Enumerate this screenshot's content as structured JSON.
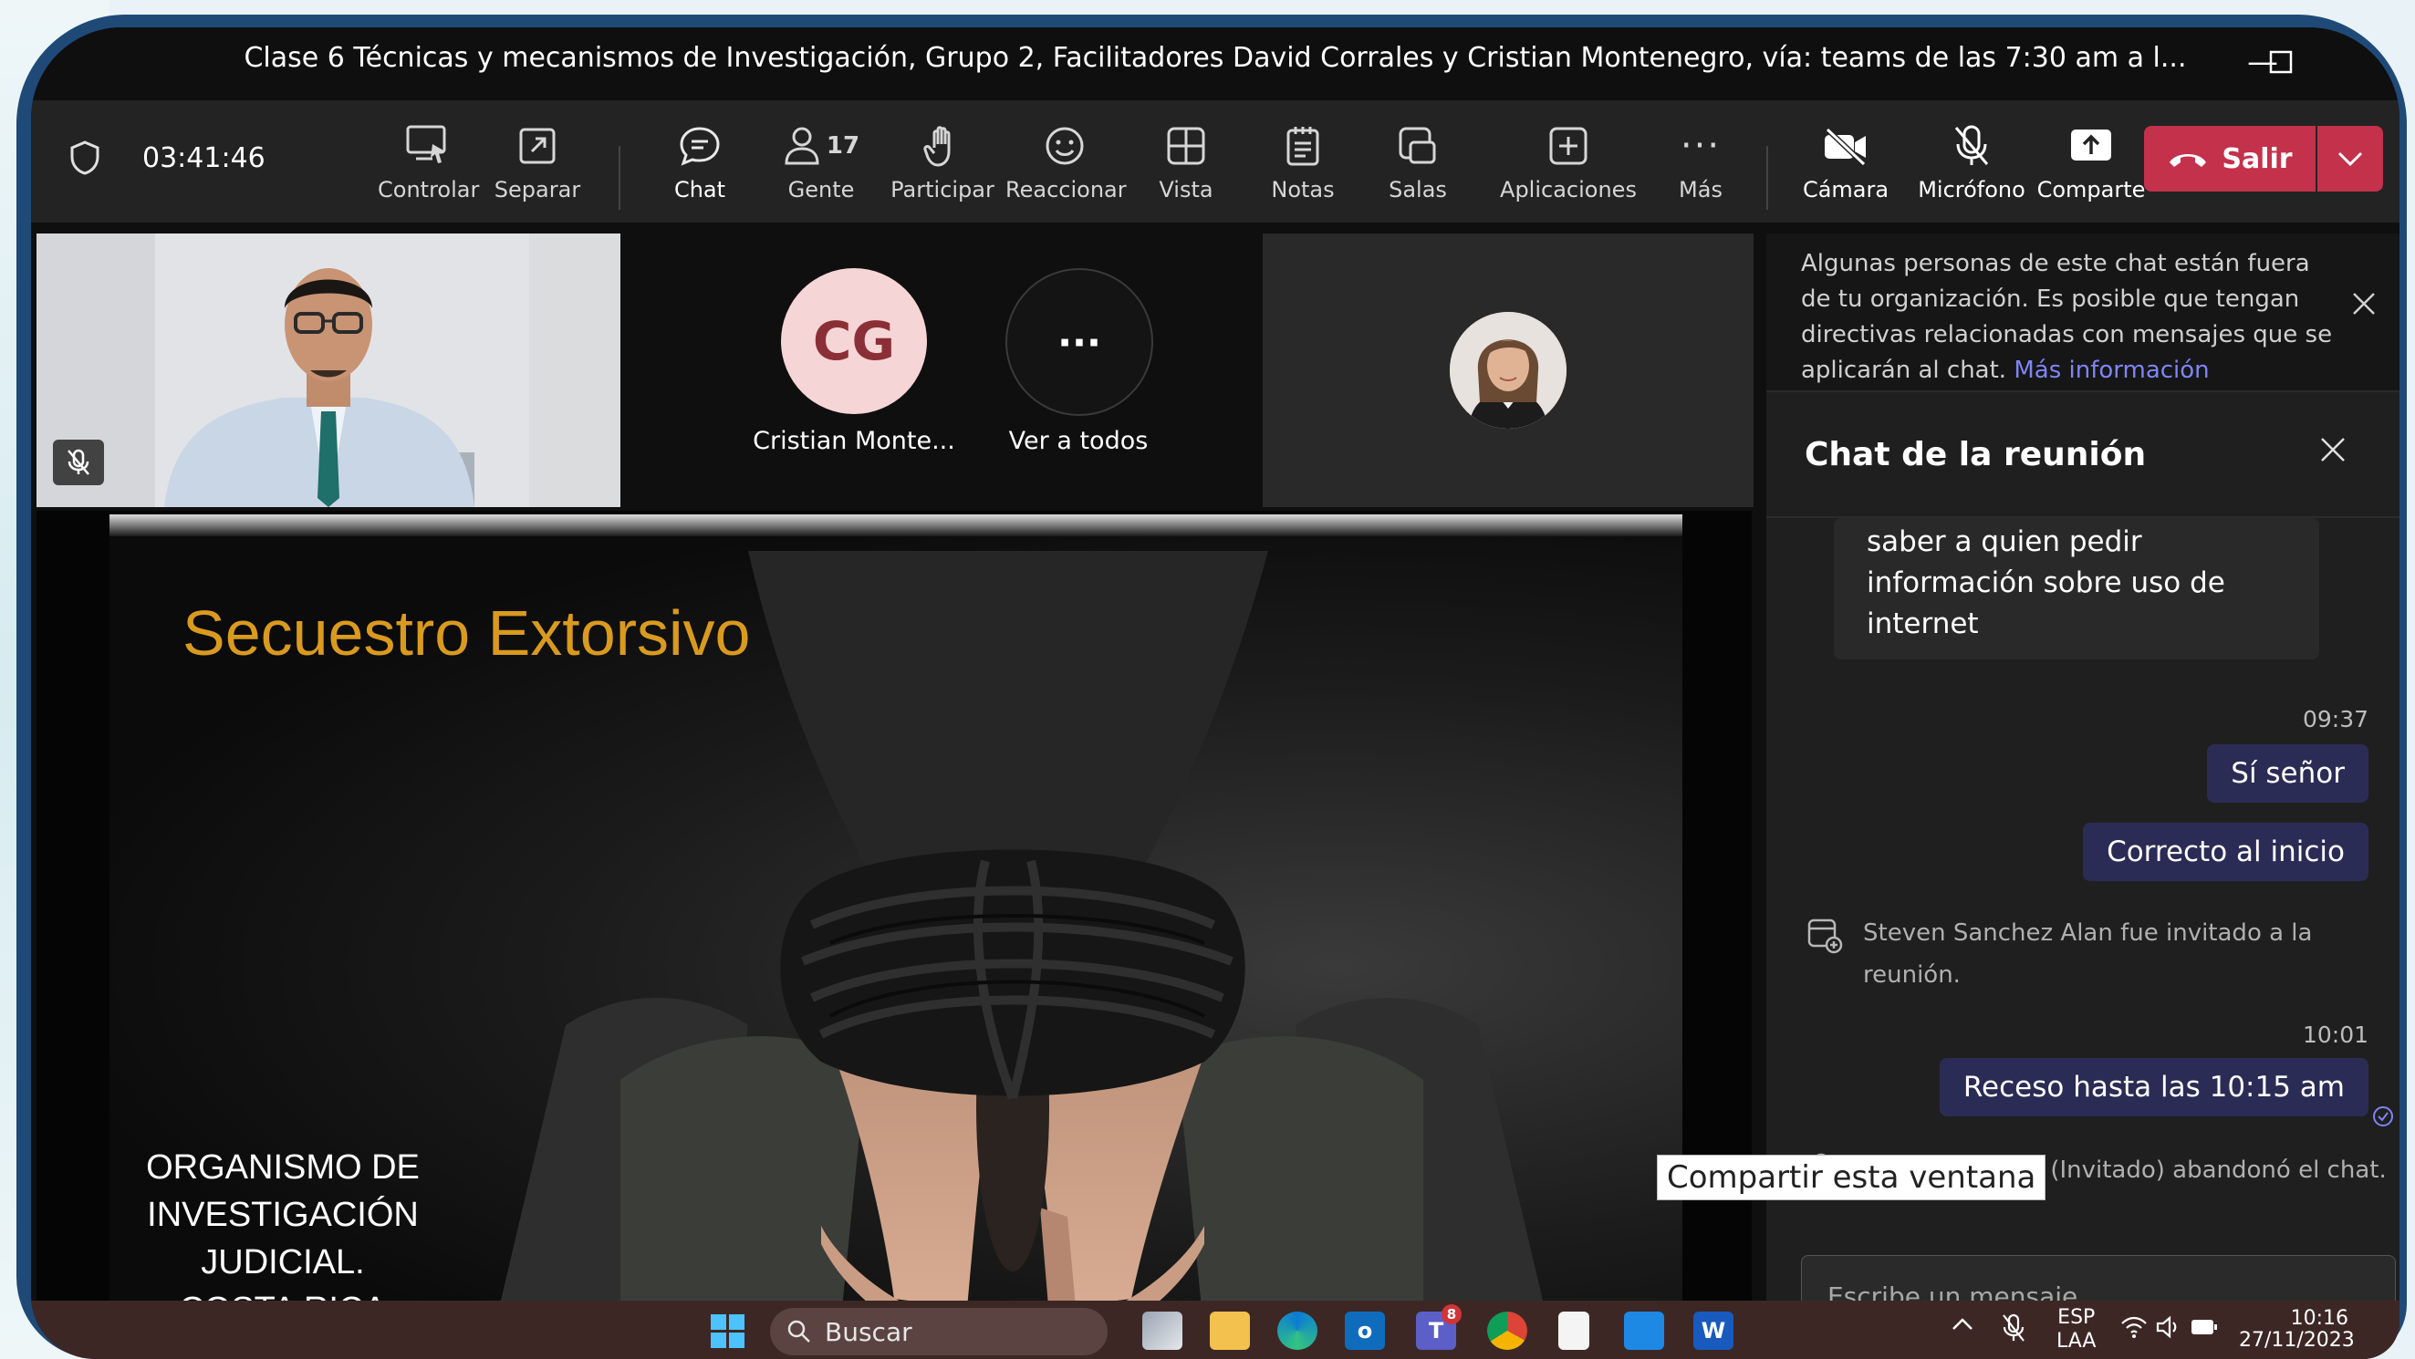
{
  "window": {
    "title": "Clase 6 Técnicas y mecanismos de Investigación,  Grupo 2, Facilitadores David Corrales y Cristian Montenegro, vía: teams de las 7:30  am a l..."
  },
  "toolbar": {
    "timer": "03:41:46",
    "controlar": "Controlar",
    "separar": "Separar",
    "chat": "Chat",
    "people_count": "17",
    "gente": "Gente",
    "participar": "Participar",
    "reaccionar": "Reaccionar",
    "vista": "Vista",
    "notas": "Notas",
    "salas": "Salas",
    "aplicaciones": "Aplicaciones",
    "mas": "Más",
    "camara": "Cámara",
    "microfono": "Micrófono",
    "comparte": "Comparte",
    "salir": "Salir",
    "accent": "#7f85f5",
    "leave_color": "#c4314b"
  },
  "participants": {
    "cg_initials": "CG",
    "cg_name": "Cristian Monte...",
    "see_all": "Ver a todos"
  },
  "slide": {
    "title": "Secuestro Extorsivo",
    "org_line1": "ORGANISMO DE",
    "org_line2": "INVESTIGACIÓN",
    "org_line3": "JUDICIAL.",
    "org_line4": "COSTA RICA",
    "title_color": "#d99a1e"
  },
  "panel": {
    "notice": "Algunas personas de este chat están fuera de tu organización. Es posible que tengan directivas relacionadas con mensajes que se aplicarán al chat.",
    "notice_link": "Más información",
    "chat_title": "Chat de la reunión",
    "msg_partial": "saber a quien pedir información sobre uso de internet",
    "ts1": "09:37",
    "msg1": "Sí señor",
    "msg2": "Correcto al inicio",
    "sys1": "Steven Sanchez Alan fue invitado a la reunión.",
    "ts2": "10:01",
    "msg3": "Receso hasta las 10:15 am",
    "sys2": "Sergio Araya M (Invitado) abandonó el chat.",
    "compose_placeholder": "Escribe un mensaje"
  },
  "tooltip": "Compartir esta ventana",
  "taskbar": {
    "search": "Buscar",
    "teams_badge": "8",
    "lang1": "ESP",
    "lang2": "LAA",
    "time": "10:16",
    "date": "27/11/2023"
  }
}
